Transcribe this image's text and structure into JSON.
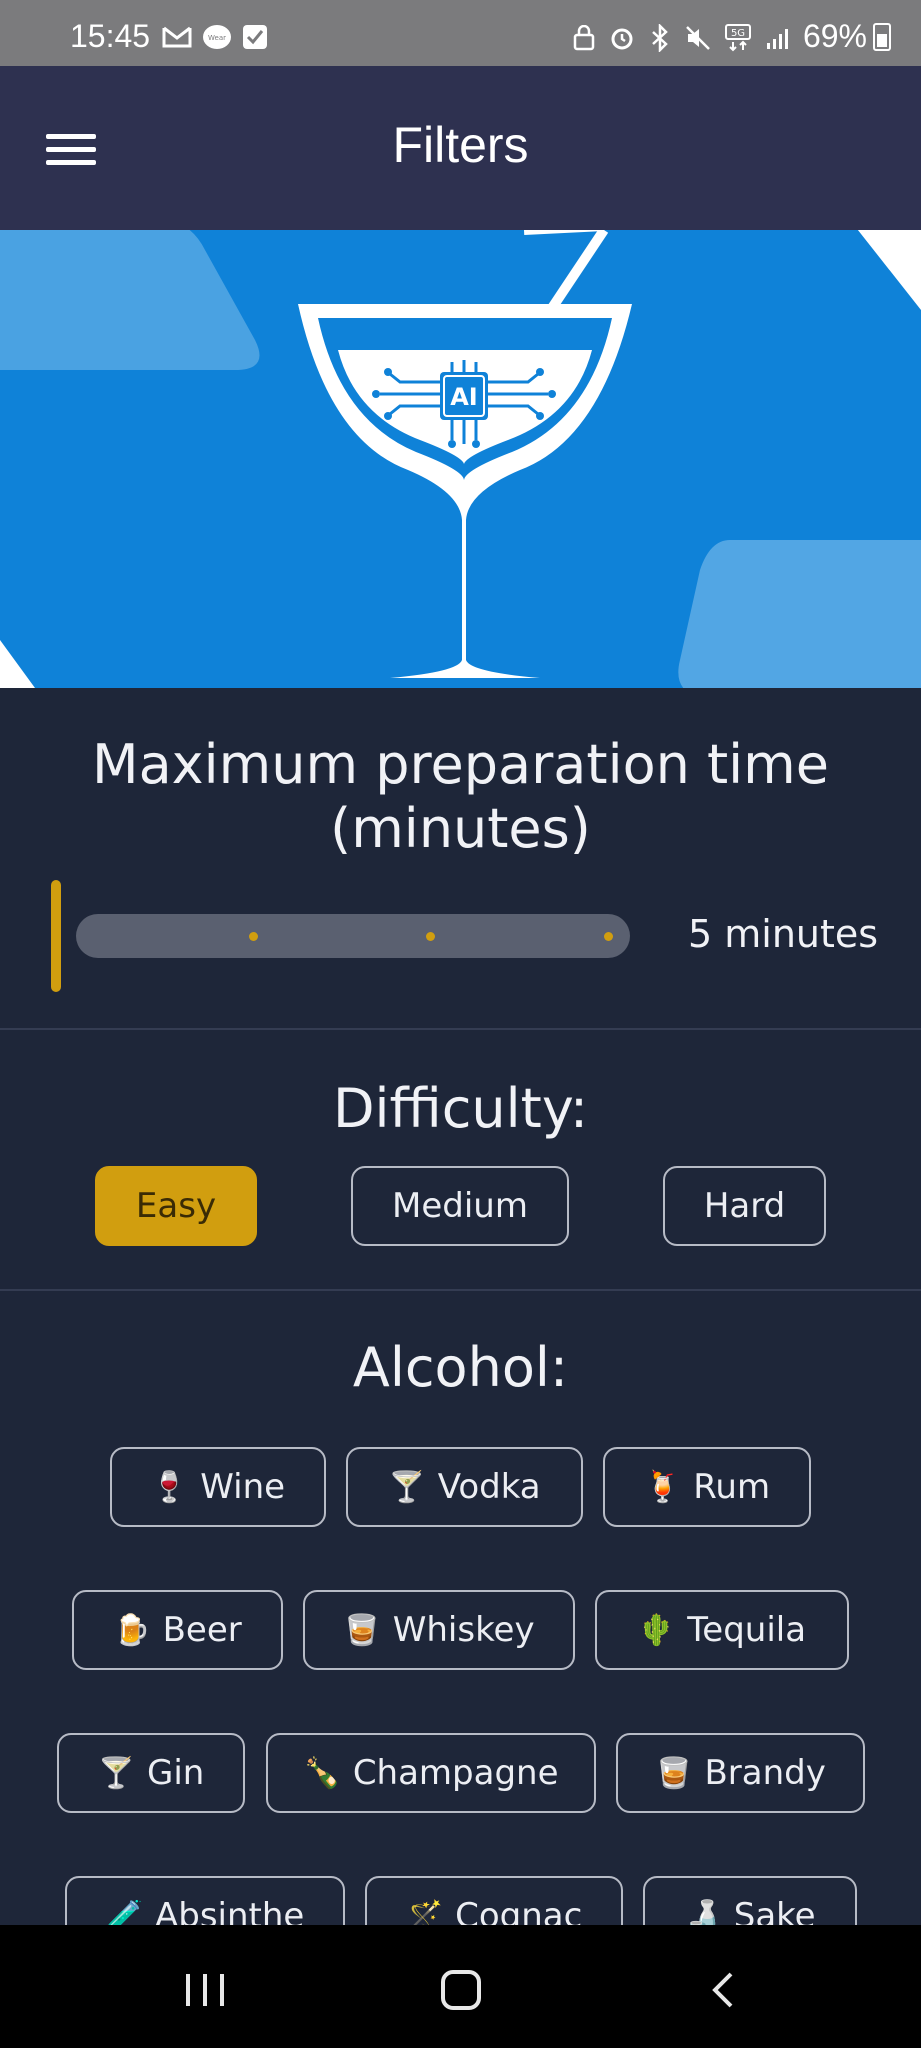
{
  "status_bar": {
    "time": "15:45",
    "battery": "69%",
    "left_icons": [
      "gmail-icon",
      "wear-icon",
      "checkbox-icon"
    ],
    "right_icons": [
      "lock-icon",
      "alarm-icon",
      "bluetooth-icon",
      "mute-icon",
      "5g-icon",
      "signal-icon"
    ]
  },
  "app_bar": {
    "title": "Filters",
    "menu_icon": "hamburger-menu-icon"
  },
  "hero": {
    "badge_text": "AI"
  },
  "prep_time": {
    "title_line1": "Maximum preparation time",
    "title_line2": "(minutes)",
    "value_label": "5 minutes",
    "slider_fraction": 0
  },
  "difficulty": {
    "title": "Difficulty:",
    "options": [
      "Easy",
      "Medium",
      "Hard"
    ],
    "selected": "Easy"
  },
  "alcohol": {
    "title": "Alcohol:",
    "items": [
      {
        "emoji": "🍷",
        "label": "Wine"
      },
      {
        "emoji": "🍸",
        "label": "Vodka"
      },
      {
        "emoji": "🍹",
        "label": "Rum"
      },
      {
        "emoji": "🍺",
        "label": "Beer"
      },
      {
        "emoji": "🥃",
        "label": "Whiskey"
      },
      {
        "emoji": "🌵",
        "label": "Tequila"
      },
      {
        "emoji": "🍸",
        "label": "Gin"
      },
      {
        "emoji": "🍾",
        "label": "Champagne"
      },
      {
        "emoji": "🥃",
        "label": "Brandy"
      },
      {
        "emoji": "🧪",
        "label": "Absinthe"
      },
      {
        "emoji": "🪄",
        "label": "Cognac"
      },
      {
        "emoji": "🍶",
        "label": "Sake"
      }
    ]
  },
  "colors": {
    "background": "#1e2639",
    "app_bar": "#2e3150",
    "accent": "#d19e0f",
    "hero_blue": "#0f82d8"
  }
}
